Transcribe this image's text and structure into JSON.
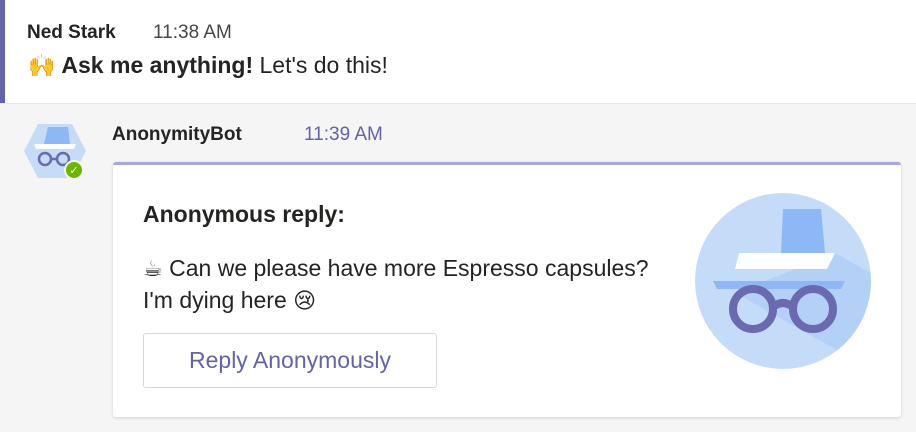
{
  "top_message": {
    "author": "Ned Stark",
    "time": "11:38 AM",
    "emoji": "🙌",
    "bold_text": "Ask me anything!",
    "rest_text": " Let's do this!"
  },
  "bot_message": {
    "author": "AnonymityBot",
    "time": "11:39 AM",
    "status": "✓",
    "card": {
      "title": "Anonymous reply:",
      "line1_emoji": "☕",
      "line1_text": " Can we please have more Espresso capsules?",
      "line2_text": "I'm dying here ",
      "line2_emoji": "😢",
      "button_label": "Reply Anonymously"
    }
  },
  "colors": {
    "accent": "#6264a7",
    "card_top_border": "#a6a7dc",
    "status_online": "#6bb700",
    "logo_bg": "#c5dcf9",
    "logo_hat": "#8db8f5",
    "logo_glasses": "#6b6ab0"
  }
}
